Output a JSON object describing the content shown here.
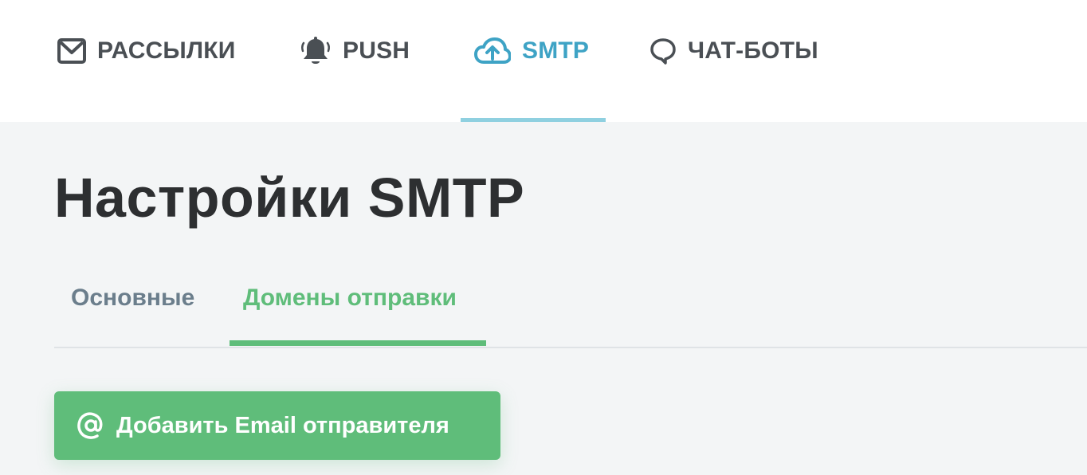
{
  "nav": {
    "items": [
      {
        "label": "РАССЫЛКИ",
        "icon": "envelope-icon"
      },
      {
        "label": "PUSH",
        "icon": "bell-icon"
      },
      {
        "label": "SMTP",
        "icon": "cloud-upload-icon",
        "active": true
      },
      {
        "label": "ЧАТ-БОТЫ",
        "icon": "chat-bubble-icon"
      }
    ]
  },
  "page": {
    "title": "Настройки SMTP"
  },
  "subtabs": [
    {
      "label": "Основные"
    },
    {
      "label": "Домены отправки",
      "active": true
    }
  ],
  "actions": {
    "add_sender_label": "Добавить Email отправителя",
    "add_sender_icon": "at-sign-icon"
  },
  "colors": {
    "nav_active": "#3ea3c5",
    "nav_underline": "#8fd0e0",
    "accent_green": "#5fbd7a",
    "text_dark": "#2d2f31",
    "text_muted": "#6b7e8c",
    "background": "#f3f5f6"
  }
}
